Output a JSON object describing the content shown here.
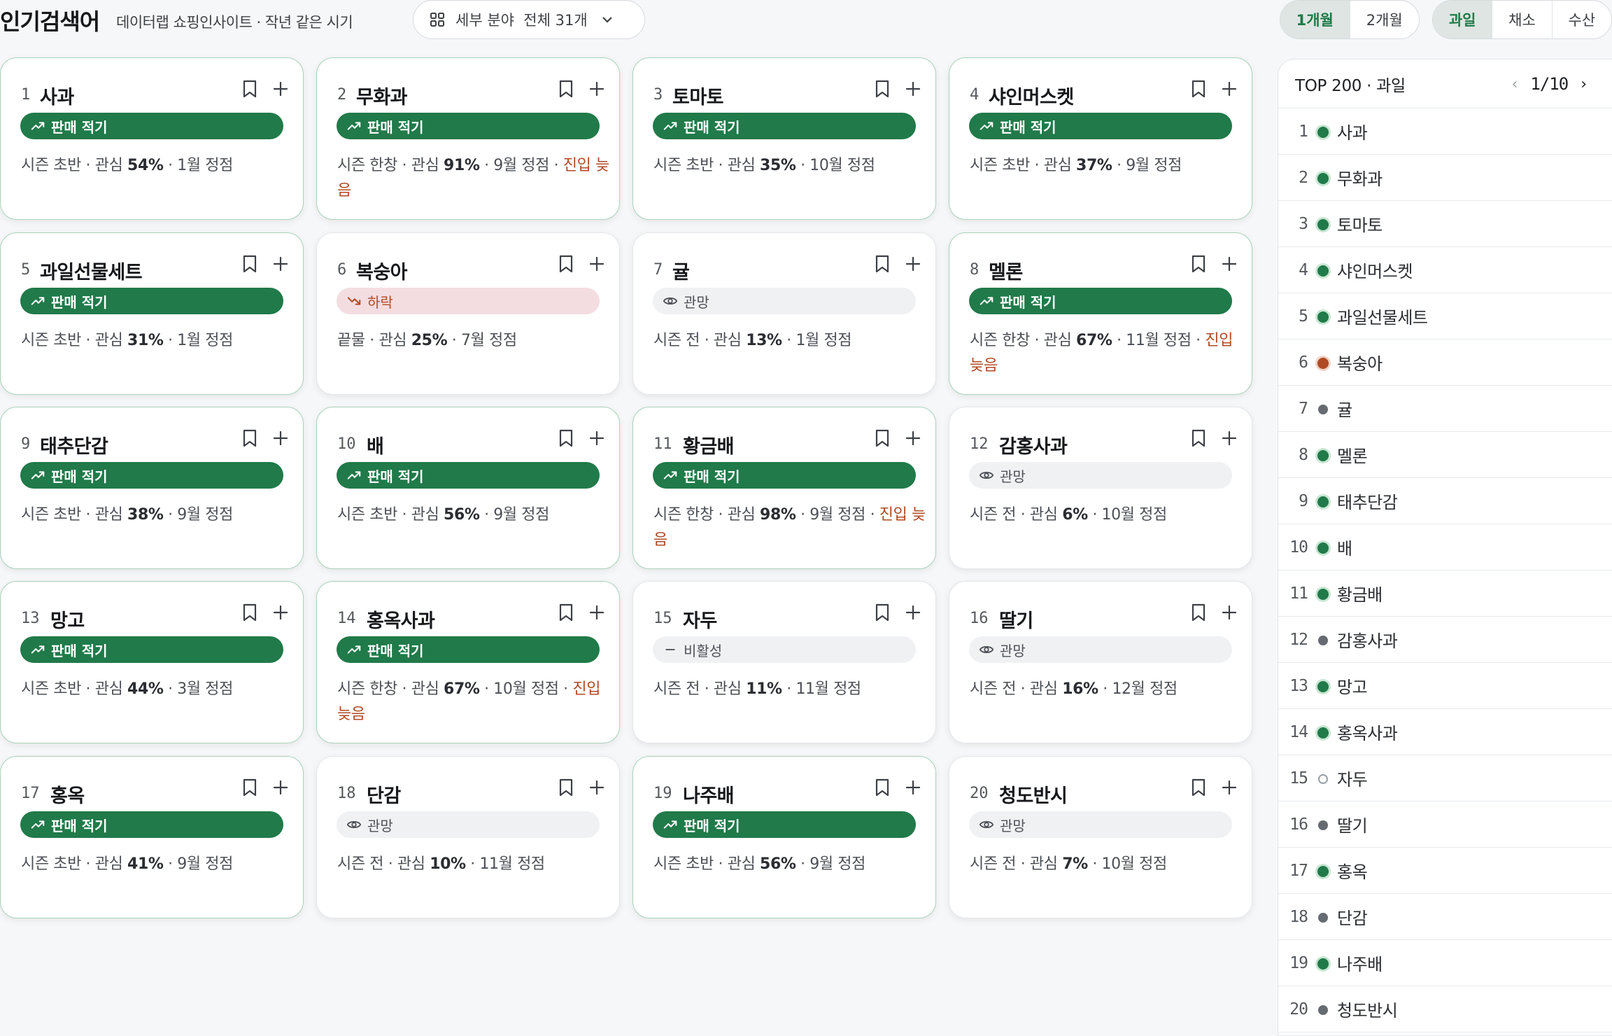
{
  "header": {
    "title": "인기검색어",
    "subtitle": "데이터랩 쇼핑인사이트 · 작년 같은 시기",
    "filter_label": "세부 분야  전체 31개",
    "period_tabs": [
      {
        "label": "1개월",
        "active": true
      },
      {
        "label": "2개월",
        "active": false
      }
    ],
    "category_tabs": [
      {
        "label": "과일",
        "active": true
      },
      {
        "label": "채소",
        "active": false
      },
      {
        "label": "수산",
        "active": false
      }
    ]
  },
  "colors": {
    "accent": "#207a49",
    "down": "#b04a24",
    "neutral": "#666b71"
  },
  "cards": [
    {
      "rank": "1",
      "name": "사과",
      "status": "sale",
      "badge": "판매 적기",
      "season": "시즌 초반",
      "interest": "54%",
      "peak": "1월 정점",
      "late": ""
    },
    {
      "rank": "2",
      "name": "무화과",
      "status": "sale",
      "badge": "판매 적기",
      "season": "시즌 한창",
      "interest": "91%",
      "peak": "9월 정점",
      "late": "진입 늦음"
    },
    {
      "rank": "3",
      "name": "토마토",
      "status": "sale",
      "badge": "판매 적기",
      "season": "시즌 초반",
      "interest": "35%",
      "peak": "10월 정점",
      "late": ""
    },
    {
      "rank": "4",
      "name": "샤인머스켓",
      "status": "sale",
      "badge": "판매 적기",
      "season": "시즌 초반",
      "interest": "37%",
      "peak": "9월 정점",
      "late": ""
    },
    {
      "rank": "5",
      "name": "과일선물세트",
      "status": "sale",
      "badge": "판매 적기",
      "season": "시즌 초반",
      "interest": "31%",
      "peak": "1월 정점",
      "late": ""
    },
    {
      "rank": "6",
      "name": "복숭아",
      "status": "down",
      "badge": "하락",
      "season": "끝물",
      "interest": "25%",
      "peak": "7월 정점",
      "late": ""
    },
    {
      "rank": "7",
      "name": "귤",
      "status": "watch",
      "badge": "관망",
      "season": "시즌 전",
      "interest": "13%",
      "peak": "1월 정점",
      "late": ""
    },
    {
      "rank": "8",
      "name": "멜론",
      "status": "sale",
      "badge": "판매 적기",
      "season": "시즌 한창",
      "interest": "67%",
      "peak": "11월 정점",
      "late": "진입 늦음"
    },
    {
      "rank": "9",
      "name": "태추단감",
      "status": "sale",
      "badge": "판매 적기",
      "season": "시즌 초반",
      "interest": "38%",
      "peak": "9월 정점",
      "late": ""
    },
    {
      "rank": "10",
      "name": "배",
      "status": "sale",
      "badge": "판매 적기",
      "season": "시즌 초반",
      "interest": "56%",
      "peak": "9월 정점",
      "late": ""
    },
    {
      "rank": "11",
      "name": "황금배",
      "status": "sale",
      "badge": "판매 적기",
      "season": "시즌 한창",
      "interest": "98%",
      "peak": "9월 정점",
      "late": "진입 늦음"
    },
    {
      "rank": "12",
      "name": "감홍사과",
      "status": "watch",
      "badge": "관망",
      "season": "시즌 전",
      "interest": "6%",
      "peak": "10월 정점",
      "late": ""
    },
    {
      "rank": "13",
      "name": "망고",
      "status": "sale",
      "badge": "판매 적기",
      "season": "시즌 초반",
      "interest": "44%",
      "peak": "3월 정점",
      "late": ""
    },
    {
      "rank": "14",
      "name": "홍옥사과",
      "status": "sale",
      "badge": "판매 적기",
      "season": "시즌 한창",
      "interest": "67%",
      "peak": "10월 정점",
      "late": "진입 늦음"
    },
    {
      "rank": "15",
      "name": "자두",
      "status": "inactive",
      "badge": "비활성",
      "season": "시즌 전",
      "interest": "11%",
      "peak": "11월 정점",
      "late": ""
    },
    {
      "rank": "16",
      "name": "딸기",
      "status": "watch",
      "badge": "관망",
      "season": "시즌 전",
      "interest": "16%",
      "peak": "12월 정점",
      "late": ""
    },
    {
      "rank": "17",
      "name": "홍옥",
      "status": "sale",
      "badge": "판매 적기",
      "season": "시즌 초반",
      "interest": "41%",
      "peak": "9월 정점",
      "late": ""
    },
    {
      "rank": "18",
      "name": "단감",
      "status": "watch",
      "badge": "관망",
      "season": "시즌 전",
      "interest": "10%",
      "peak": "11월 정점",
      "late": ""
    },
    {
      "rank": "19",
      "name": "나주배",
      "status": "sale",
      "badge": "판매 적기",
      "season": "시즌 초반",
      "interest": "56%",
      "peak": "9월 정점",
      "late": ""
    },
    {
      "rank": "20",
      "name": "청도반시",
      "status": "watch",
      "badge": "관망",
      "season": "시즌 전",
      "interest": "7%",
      "peak": "10월 정점",
      "late": ""
    }
  ],
  "panel": {
    "title": "TOP 200 · 과일",
    "page": "1/10",
    "prev_icon": "chevron-left-icon",
    "next_icon": "chevron-right-icon",
    "items": [
      {
        "rank": "1",
        "name": "사과",
        "status": "good"
      },
      {
        "rank": "2",
        "name": "무화과",
        "status": "good"
      },
      {
        "rank": "3",
        "name": "토마토",
        "status": "good"
      },
      {
        "rank": "4",
        "name": "샤인머스켓",
        "status": "good"
      },
      {
        "rank": "5",
        "name": "과일선물세트",
        "status": "good"
      },
      {
        "rank": "6",
        "name": "복숭아",
        "status": "down"
      },
      {
        "rank": "7",
        "name": "귤",
        "status": "neutral"
      },
      {
        "rank": "8",
        "name": "멜론",
        "status": "good"
      },
      {
        "rank": "9",
        "name": "태추단감",
        "status": "good"
      },
      {
        "rank": "10",
        "name": "배",
        "status": "good"
      },
      {
        "rank": "11",
        "name": "황금배",
        "status": "good"
      },
      {
        "rank": "12",
        "name": "감홍사과",
        "status": "neutral"
      },
      {
        "rank": "13",
        "name": "망고",
        "status": "good"
      },
      {
        "rank": "14",
        "name": "홍옥사과",
        "status": "good"
      },
      {
        "rank": "15",
        "name": "자두",
        "status": "inactive"
      },
      {
        "rank": "16",
        "name": "딸기",
        "status": "neutral"
      },
      {
        "rank": "17",
        "name": "홍옥",
        "status": "good"
      },
      {
        "rank": "18",
        "name": "단감",
        "status": "neutral"
      },
      {
        "rank": "19",
        "name": "나주배",
        "status": "good"
      },
      {
        "rank": "20",
        "name": "청도반시",
        "status": "neutral"
      }
    ]
  }
}
